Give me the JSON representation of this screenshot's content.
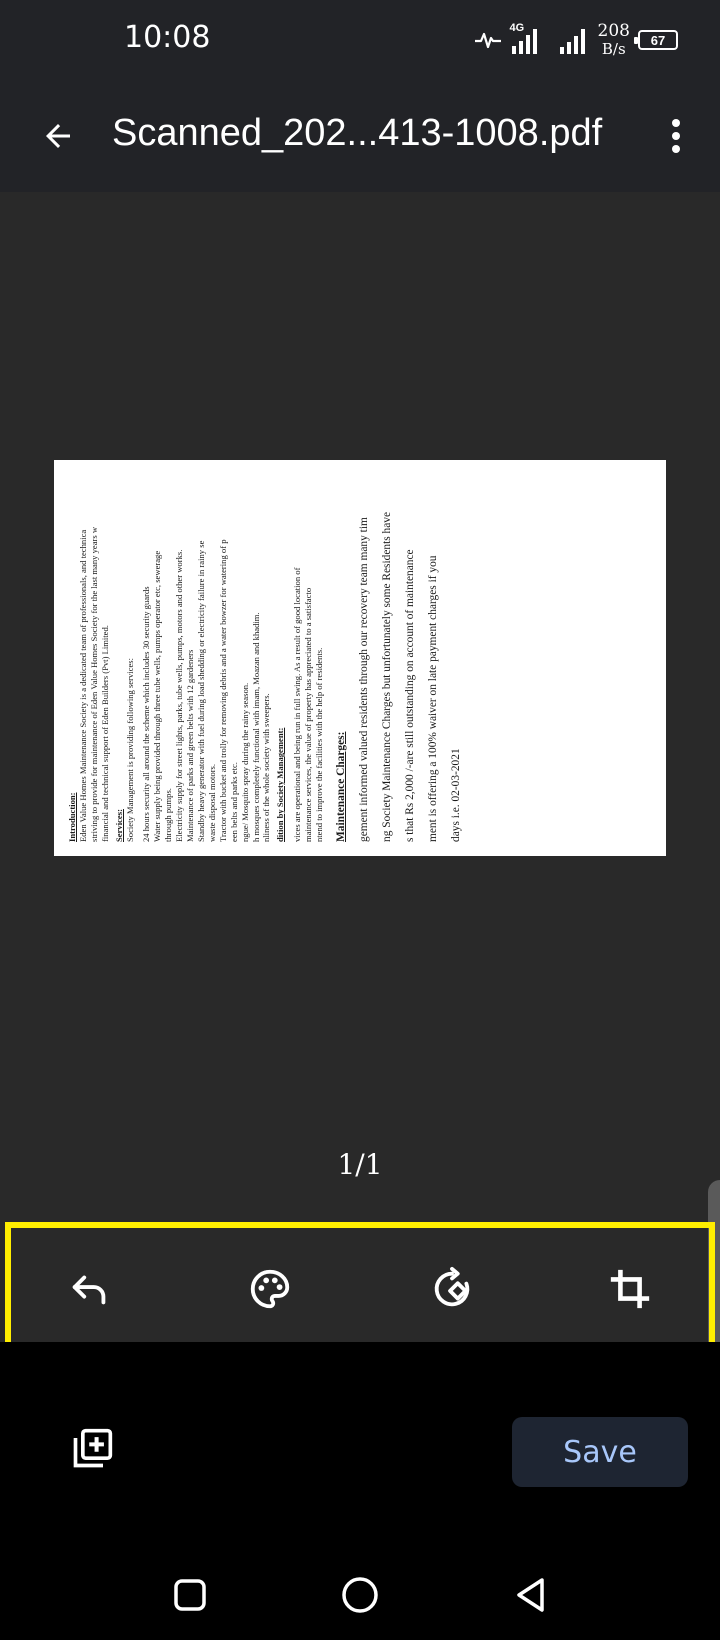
{
  "status_bar": {
    "time": "10:08",
    "network_type": "4G",
    "net_speed_value": "208",
    "net_speed_unit": "B/s",
    "battery_level": "67"
  },
  "app_bar": {
    "file_name": "Scanned_202...413-1008.pdf"
  },
  "document_preview": {
    "lines": [
      "Introduction:",
      "Eden Value Homes Maintenance Society is a dedicated team of professionals, and technica",
      "striving to provide for maintenance of Eden Value Homes Society for the last many years w",
      "financial and technical support of Eden Builders (Pvt) Limited.",
      "Services:",
      "Society Management is providing following services:",
      "24 hours security all around the scheme which includes 30 security guards",
      "Water supply being provided through three tube wells, pumps operator etc, sewerage",
      "through pumps.",
      "Electricity supply for street lights, parks, tube wells, pumps, motors and other works.",
      "Maintenance of parks and green belts with 12 gardeners",
      "Standby heavy generator with fuel during load shedding or electricity failure in rainy se",
      "waste disposal motors.",
      "Tractor with bucket and trolly for removing debris and a water bowzer for watering of p",
      "een belts and parks etc.",
      "ngue/ Mosquito spray during the rainy season.",
      "h mosques completely functional with imam, Moazan and khadim.",
      "nliness of the whole society with sweepers.",
      "dition by Society Management:",
      "vices are operational and being run in full swing. As a result of good location of",
      "maintenance services, the value of property has appreciated to a satisfacto",
      "ntend to improve the facilities with the help of residents.",
      "Maintenance Charges:",
      "gement informed valued residents through our recovery team many tim",
      "ng Society Maintenance Charges but unfortunately some Residents have",
      "s that Rs 2,000 /-are still outstanding on account of maintenance",
      "ment is offering a 100% waiver on late payment charges if you",
      "days i.e. 02-03-2021"
    ],
    "page_indicator": "1/1"
  },
  "edit_toolbar": {
    "tools": [
      "undo-icon",
      "palette-icon",
      "rotate-icon",
      "crop-icon"
    ],
    "highlight_color": "#ffee00"
  },
  "bottom_bar": {
    "save_label": "Save",
    "save_text_color": "#a8c7fa"
  },
  "colors": {
    "app_bar_bg": "#222327",
    "preview_bg": "#292929",
    "save_button_bg": "#1e2532"
  }
}
